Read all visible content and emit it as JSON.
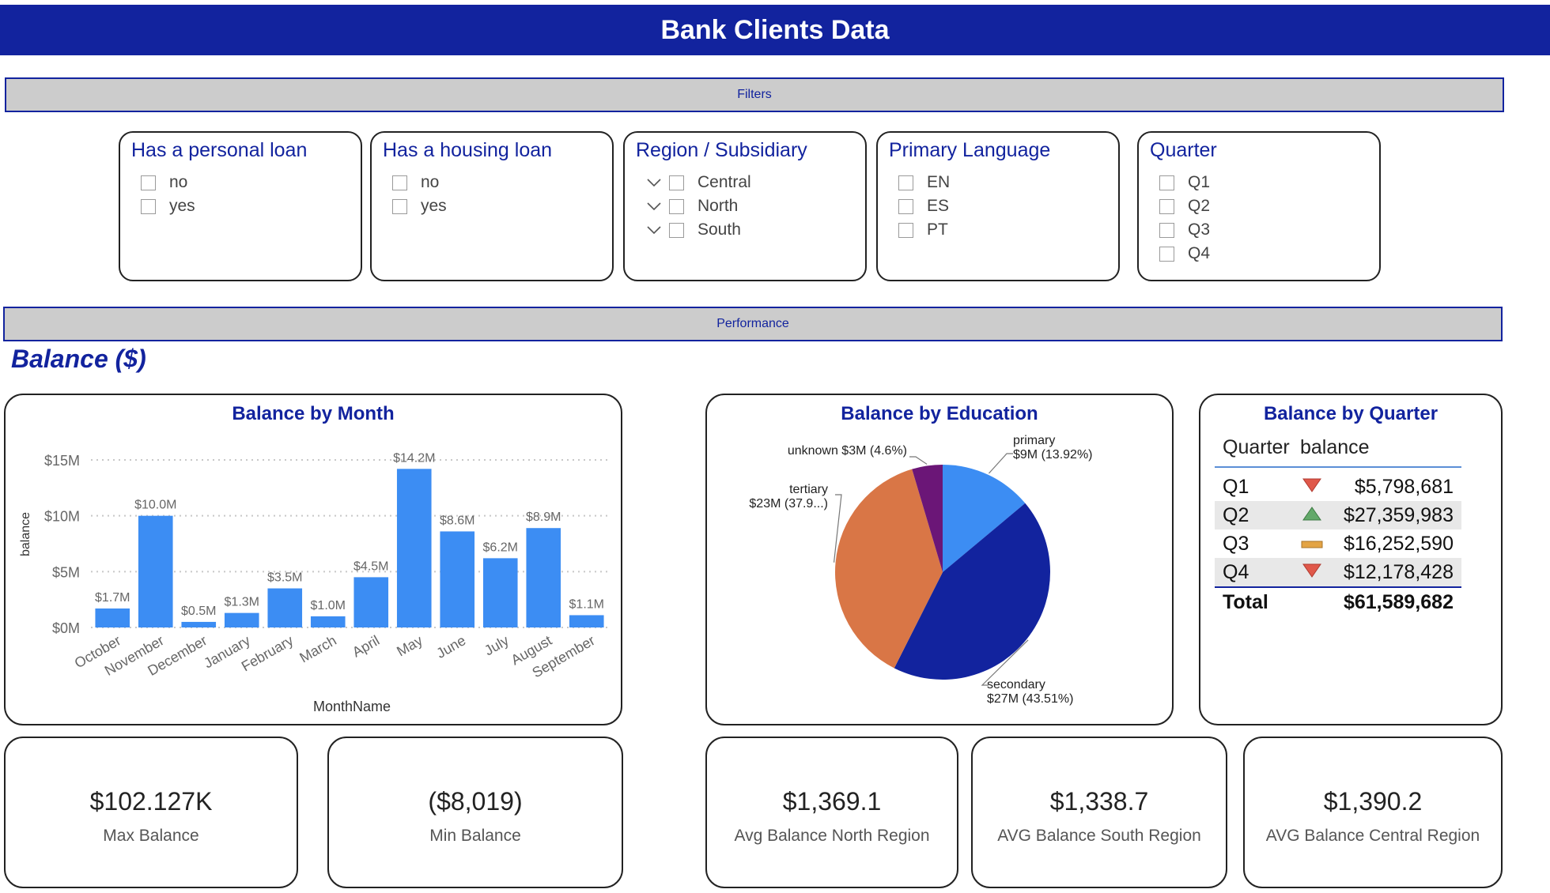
{
  "header": {
    "title": "Bank Clients Data"
  },
  "sections": {
    "filters": "Filters",
    "performance": "Performance"
  },
  "slicers": {
    "personal_loan": {
      "title": "Has a personal loan",
      "items": [
        "no",
        "yes"
      ]
    },
    "housing_loan": {
      "title": "Has a housing loan",
      "items": [
        "no",
        "yes"
      ]
    },
    "region": {
      "title": "Region / Subsidiary",
      "items": [
        "Central",
        "North",
        "South"
      ]
    },
    "language": {
      "title": "Primary Language",
      "items": [
        "EN",
        "ES",
        "PT"
      ]
    },
    "quarter": {
      "title": "Quarter",
      "items": [
        "Q1",
        "Q2",
        "Q3",
        "Q4"
      ]
    }
  },
  "balance_heading": "Balance ($)",
  "month_chart": {
    "title": "Balance by Month"
  },
  "education_chart": {
    "title": "Balance by Education"
  },
  "quarter_table": {
    "title": "Balance by Quarter",
    "headers": [
      "Quarter",
      "balance"
    ],
    "rows": [
      {
        "quarter": "Q1",
        "indicator": "down-triangle-icon",
        "color": "#E0584A",
        "value": "$5,798,681"
      },
      {
        "quarter": "Q2",
        "indicator": "up-triangle-icon",
        "color": "#63A96A",
        "value": "$27,359,983"
      },
      {
        "quarter": "Q3",
        "indicator": "flat-bar-icon",
        "color": "#E3A444",
        "value": "$16,252,590"
      },
      {
        "quarter": "Q4",
        "indicator": "down-triangle-icon",
        "color": "#E0584A",
        "value": "$12,178,428"
      }
    ],
    "total_label": "Total",
    "total_value": "$61,589,682"
  },
  "kpis": [
    {
      "value": "$102.127K",
      "label": "Max Balance"
    },
    {
      "value": "($8,019)",
      "label": "Min Balance"
    },
    {
      "value": "$1,369.1",
      "label": "Avg Balance North Region"
    },
    {
      "value": "$1,338.7",
      "label": "AVG Balance South Region"
    },
    {
      "value": "$1,390.2",
      "label": "AVG Balance Central Region"
    }
  ],
  "colors": {
    "brand": "#12239E",
    "bar": "#3C8DF3",
    "section_bg": "#CCCCCC"
  },
  "chart_data": [
    {
      "type": "bar",
      "title": "Balance by Month",
      "xlabel": "MonthName",
      "ylabel": "balance",
      "categories": [
        "October",
        "November",
        "December",
        "January",
        "February",
        "March",
        "April",
        "May",
        "June",
        "July",
        "August",
        "September"
      ],
      "values": [
        1.7,
        10.0,
        0.5,
        1.3,
        3.5,
        1.0,
        4.5,
        14.2,
        8.6,
        6.2,
        8.9,
        1.1
      ],
      "value_unit": "$M",
      "data_labels": [
        "$1.7M",
        "$10.0M",
        "$0.5M",
        "$1.3M",
        "$3.5M",
        "$1.0M",
        "$4.5M",
        "$14.2M",
        "$8.6M",
        "$6.2M",
        "$8.9M",
        "$1.1M"
      ],
      "y_ticks": [
        0,
        5,
        10,
        15
      ],
      "y_tick_labels": [
        "$0M",
        "$5M",
        "$10M",
        "$15M"
      ],
      "ylim": [
        0,
        15
      ],
      "grid": true,
      "color": "#3C8DF3"
    },
    {
      "type": "pie",
      "title": "Balance by Education",
      "slices": [
        {
          "label": "primary",
          "value": 9,
          "percent": 13.92,
          "color": "#3C8DF3",
          "text": [
            "primary",
            "$9M (13.92%)"
          ]
        },
        {
          "label": "secondary",
          "value": 27,
          "percent": 43.51,
          "color": "#12239E",
          "text": [
            "secondary",
            "$27M (43.51%)"
          ]
        },
        {
          "label": "tertiary",
          "value": 23,
          "percent": 37.97,
          "color": "#D97646",
          "text": [
            "tertiary",
            "$23M (37.9...)"
          ]
        },
        {
          "label": "unknown",
          "value": 3,
          "percent": 4.6,
          "color": "#6B1677",
          "text": [
            "unknown $3M (4.6%)"
          ]
        }
      ]
    }
  ]
}
